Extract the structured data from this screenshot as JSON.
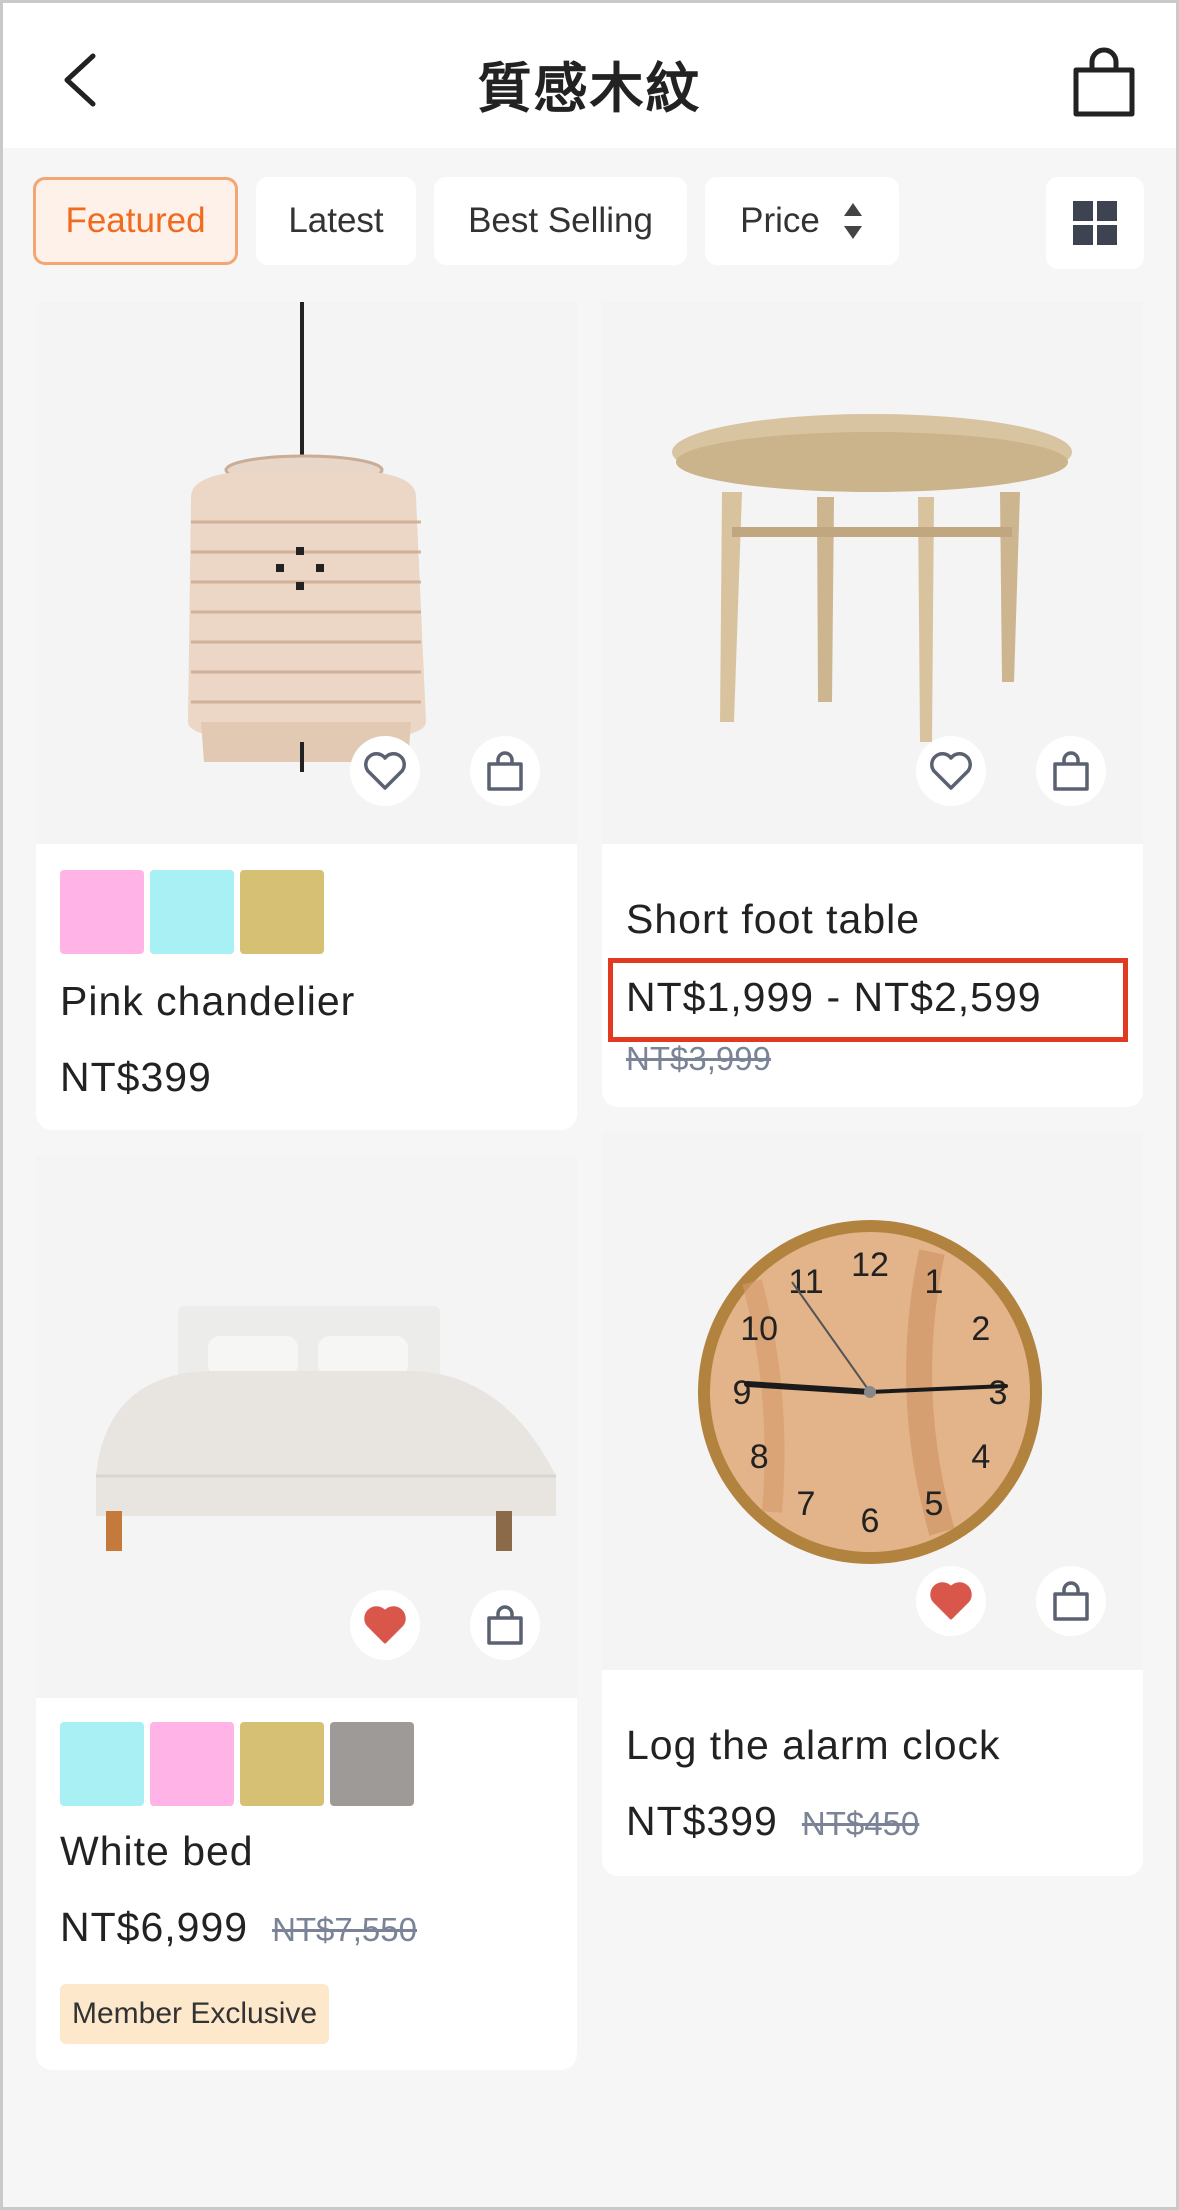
{
  "header": {
    "title": "質感木紋",
    "back_icon": "chevron-left-icon",
    "cart_icon": "shopping-bag-icon"
  },
  "filters": {
    "featured": "Featured",
    "latest": "Latest",
    "best_selling": "Best Selling",
    "price": "Price",
    "active": "Featured",
    "accent_color": "#f06a1f",
    "layout_icon": "grid-view-icon"
  },
  "products": [
    {
      "name": "Pink chandelier",
      "price": "NT$399",
      "old_price": "",
      "swatches": [
        "#ffb3e6",
        "#a8f0f4",
        "#d6c073"
      ],
      "favorited": false,
      "badge": ""
    },
    {
      "name": "Short foot table",
      "price": "NT$1,999 - NT$2,599",
      "old_price": "NT$3,999",
      "swatches": [],
      "favorited": false,
      "badge": ""
    },
    {
      "name": "White bed",
      "price": "NT$6,999",
      "old_price": "NT$7,550",
      "swatches": [
        "#a8f0f4",
        "#ffb3e6",
        "#d6c073",
        "#9d9a97"
      ],
      "favorited": true,
      "badge": "Member Exclusive"
    },
    {
      "name": "Log the alarm clock",
      "price": "NT$399",
      "old_price": "NT$450",
      "swatches": [],
      "favorited": true,
      "badge": ""
    }
  ],
  "clock_numerals": [
    "12",
    "1",
    "2",
    "3",
    "4",
    "5",
    "6",
    "7",
    "8",
    "9",
    "10",
    "11"
  ],
  "colors": {
    "favorite_filled": "#d8564a",
    "highlight": "#e23a22"
  }
}
